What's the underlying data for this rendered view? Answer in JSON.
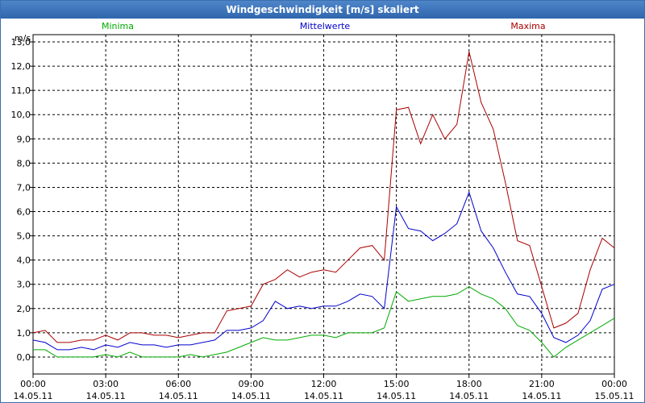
{
  "window": {
    "title": "Windgeschwindigkeit [m/s] skaliert"
  },
  "chart_data": {
    "type": "line",
    "title": "Windgeschwindigkeit [m/s] skaliert",
    "ylabel": "m/s",
    "xlabel": "",
    "ylim": [
      -0.7,
      13.3
    ],
    "xlim": [
      0,
      24
    ],
    "grid": true,
    "legend_placement": "top",
    "yticks": [
      0,
      1,
      2,
      3,
      4,
      5,
      6,
      7,
      8,
      9,
      10,
      11,
      12,
      13
    ],
    "ytick_labels": [
      "0,0",
      "1,0",
      "2,0",
      "3,0",
      "4,0",
      "5,0",
      "6,0",
      "7,0",
      "8,0",
      "9,0",
      "10,0",
      "11,0",
      "12,0",
      "13,0"
    ],
    "xticks": [
      0,
      3,
      6,
      9,
      12,
      15,
      18,
      21,
      24
    ],
    "xtick_labels": [
      [
        "00:00",
        "14.05.11"
      ],
      [
        "03:00",
        "14.05.11"
      ],
      [
        "06:00",
        "14.05.11"
      ],
      [
        "09:00",
        "14.05.11"
      ],
      [
        "12:00",
        "14.05.11"
      ],
      [
        "15:00",
        "14.05.11"
      ],
      [
        "18:00",
        "14.05.11"
      ],
      [
        "21:00",
        "14.05.11"
      ],
      [
        "00:00",
        "15.05.11"
      ]
    ],
    "x": [
      0,
      0.5,
      1,
      1.5,
      2,
      2.5,
      3,
      3.5,
      4,
      4.5,
      5,
      5.5,
      6,
      6.5,
      7,
      7.5,
      8,
      8.5,
      9,
      9.5,
      10,
      10.5,
      11,
      11.5,
      12,
      12.5,
      13,
      13.5,
      14,
      14.5,
      15,
      15.5,
      16,
      16.5,
      17,
      17.5,
      18,
      18.5,
      19,
      19.5,
      20,
      20.5,
      21,
      21.5,
      22,
      22.5,
      23,
      23.5,
      24
    ],
    "series": [
      {
        "name": "Minima",
        "color": "#00aa00",
        "values": [
          0.3,
          0.3,
          0,
          0,
          0,
          0,
          0.1,
          0,
          0.2,
          0,
          0,
          0,
          0,
          0.1,
          0,
          0.1,
          0.2,
          0.4,
          0.6,
          0.8,
          0.7,
          0.7,
          0.8,
          0.9,
          0.9,
          0.8,
          1.0,
          1.0,
          1.0,
          1.2,
          2.7,
          2.3,
          2.4,
          2.5,
          2.5,
          2.6,
          2.9,
          2.6,
          2.4,
          2.0,
          1.3,
          1.1,
          0.6,
          0.0,
          0.4,
          0.7,
          1.0,
          1.3,
          1.6
        ]
      },
      {
        "name": "Mittelwerte",
        "color": "#0000cc",
        "values": [
          0.7,
          0.6,
          0.3,
          0.3,
          0.4,
          0.3,
          0.5,
          0.4,
          0.6,
          0.5,
          0.5,
          0.4,
          0.5,
          0.5,
          0.6,
          0.7,
          1.1,
          1.1,
          1.2,
          1.5,
          2.3,
          2.0,
          2.1,
          2.0,
          2.1,
          2.1,
          2.3,
          2.6,
          2.5,
          2.0,
          6.2,
          5.3,
          5.2,
          4.8,
          5.1,
          5.5,
          6.8,
          5.2,
          4.5,
          3.5,
          2.6,
          2.5,
          1.8,
          0.8,
          0.6,
          0.9,
          1.5,
          2.8,
          3.0
        ]
      },
      {
        "name": "Maxima",
        "color": "#aa0000",
        "values": [
          1.0,
          1.1,
          0.6,
          0.6,
          0.7,
          0.7,
          0.9,
          0.7,
          1.0,
          1.0,
          0.9,
          0.9,
          0.8,
          0.9,
          1.0,
          1.0,
          1.9,
          2.0,
          2.1,
          3.0,
          3.2,
          3.6,
          3.3,
          3.5,
          3.6,
          3.5,
          4.0,
          4.5,
          4.6,
          4.0,
          10.2,
          10.3,
          8.8,
          10.0,
          9.0,
          9.6,
          12.6,
          10.5,
          9.4,
          7.2,
          4.8,
          4.6,
          2.9,
          1.2,
          1.4,
          1.8,
          3.6,
          4.9,
          4.5
        ]
      }
    ]
  }
}
